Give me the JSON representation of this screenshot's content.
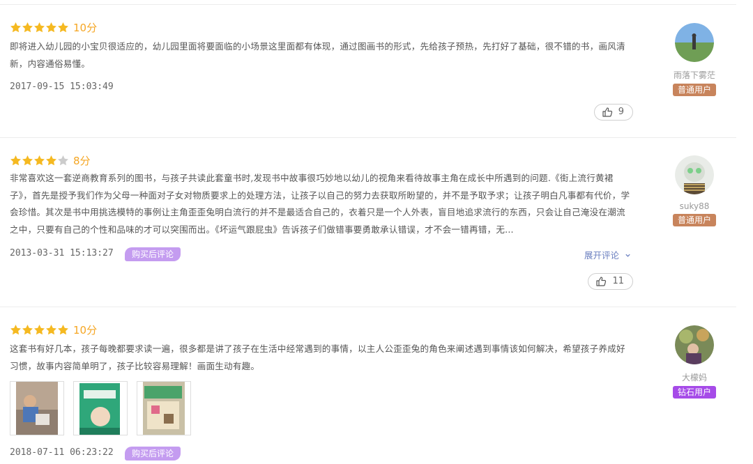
{
  "reviews": [
    {
      "stars": 5,
      "score": "10分",
      "text": "即将进入幼儿园的小宝贝很适应的，幼儿园里面将要面临的小场景这里面都有体现，通过图画书的形式，先给孩子预热，先打好了基础，很不错的书，画风清新，内容通俗易懂。",
      "date": "2017-09-15 15:03:49",
      "likes": "9",
      "user": {
        "name": "雨落下雾茫",
        "level": "普通用户"
      }
    },
    {
      "stars": 4,
      "score": "8分",
      "text": "非常喜欢这一套逆商教育系列的图书，与孩子共读此套童书时,发现书中故事很巧妙地以幼儿的视角来看待故事主角在成长中所遇到的问题.《街上流行黄裙子》，首先是授予我们作为父母一种面对子女对物质要求上的处理方法，让孩子以自己的努力去获取所盼望的，并不是予取予求；让孩子明白凡事都有代价，学会珍惜。其次是书中用挑选模特的事例让主角歪歪兔明白流行的并不是最适合自己的，衣着只是一个人外表，盲目地追求流行的东西，只会让自己淹没在潮流之中，只要有自己的个性和品味的才可以突围而出。《坏运气跟屁虫》告诉孩子们做错事要勇敢承认错误，才不会一错再错，无...",
      "date": "2013-03-31 15:13:27",
      "tag": "购买后评论",
      "expand": "展开评论",
      "likes": "11",
      "user": {
        "name": "suky88",
        "level": "普通用户"
      }
    },
    {
      "stars": 5,
      "score": "10分",
      "text": "这套书有好几本，孩子每晚都要求读一遍，很多都是讲了孩子在生活中经常遇到的事情，以主人公歪歪兔的角色来阐述遇到事情该如何解决，希望孩子养成好习惯，故事内容简单明了，孩子比较容易理解！画面生动有趣。",
      "date": "2018-07-11 06:23:22",
      "tag": "购买后评论",
      "user": {
        "name": "大檬妈",
        "level": "钻石用户"
      }
    }
  ],
  "colors": {
    "star_filled": "#f5b921",
    "star_empty": "#cccccc",
    "score": "#f5a623",
    "tag_bg": "#c49cf0",
    "level_normal": "#c8845c",
    "level_diamond": "#a64be8",
    "expand_link": "#6a7fc0"
  },
  "icons": [
    "star-icon",
    "thumbs-up-icon",
    "chevron-down-icon"
  ]
}
